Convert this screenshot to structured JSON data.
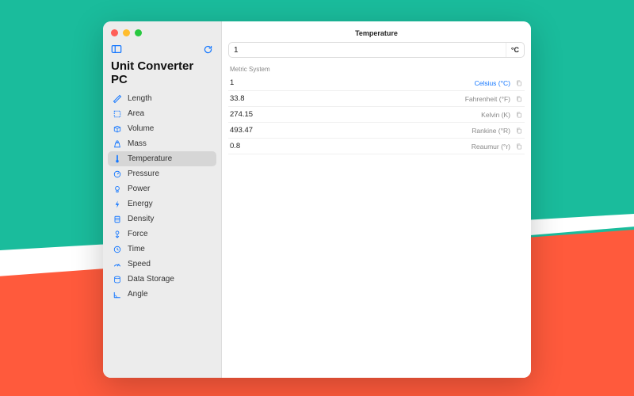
{
  "app_title": "Unit Converter PC",
  "icons": {
    "sidebar_left": "sidebar-toggle",
    "sidebar_right": "refresh"
  },
  "sidebar": {
    "items": [
      {
        "label": "Length",
        "icon": "ruler"
      },
      {
        "label": "Area",
        "icon": "crop"
      },
      {
        "label": "Volume",
        "icon": "box"
      },
      {
        "label": "Mass",
        "icon": "weight"
      },
      {
        "label": "Temperature",
        "icon": "thermometer"
      },
      {
        "label": "Pressure",
        "icon": "gauge"
      },
      {
        "label": "Power",
        "icon": "bulb"
      },
      {
        "label": "Energy",
        "icon": "bolt"
      },
      {
        "label": "Density",
        "icon": "drop"
      },
      {
        "label": "Force",
        "icon": "force"
      },
      {
        "label": "Time",
        "icon": "clock"
      },
      {
        "label": "Speed",
        "icon": "speed"
      },
      {
        "label": "Data Storage",
        "icon": "disk"
      },
      {
        "label": "Angle",
        "icon": "angle"
      }
    ],
    "selected_index": 4
  },
  "main": {
    "title": "Temperature",
    "input_value": "1",
    "input_unit_suffix": "°C",
    "section_label": "Metric System",
    "results": [
      {
        "value": "1",
        "unit": "Celsius (°C)",
        "current": true
      },
      {
        "value": "33.8",
        "unit": "Fahrenheit (°F)",
        "current": false
      },
      {
        "value": "274.15",
        "unit": "Kelvin (K)",
        "current": false
      },
      {
        "value": "493.47",
        "unit": "Rankine (°R)",
        "current": false
      },
      {
        "value": "0.8",
        "unit": "Reaumur (°r)",
        "current": false
      }
    ]
  },
  "colors": {
    "accent": "#1477ff"
  }
}
